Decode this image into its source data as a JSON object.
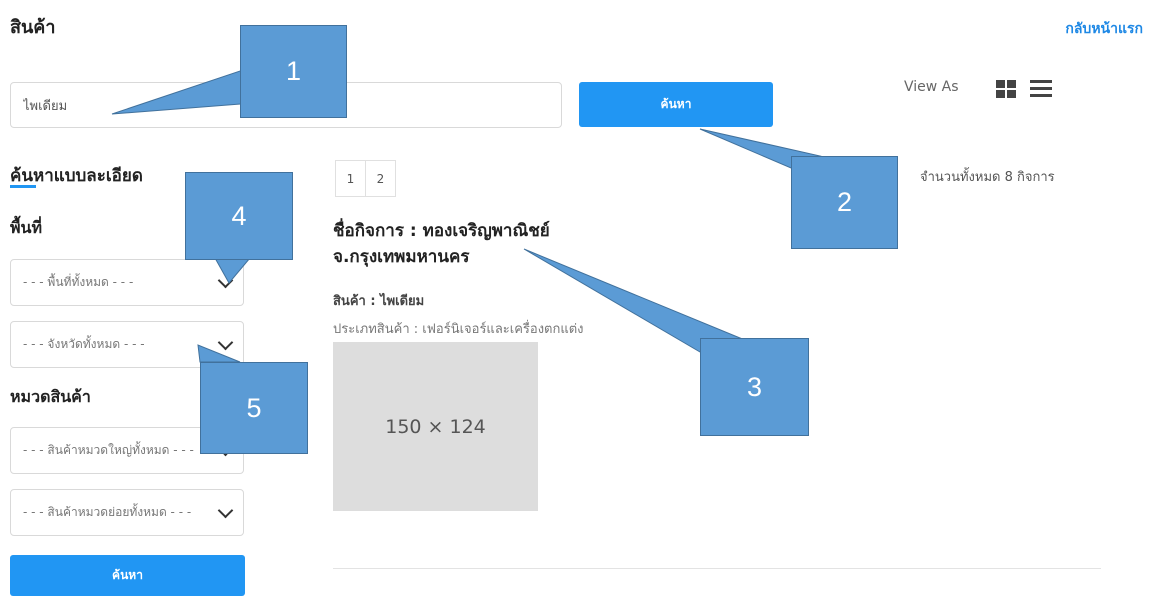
{
  "header": {
    "title": "สินค้า",
    "home_link": "กลับหน้าแรก"
  },
  "search": {
    "value": "ไพเดียม",
    "button_label": "ค้นหา"
  },
  "view": {
    "label": "View As",
    "grid_icon": "grid-icon",
    "list_icon": "list-icon"
  },
  "advanced": {
    "title": "ค้นหาแบบละเอียด",
    "area_label": "พื้นที่",
    "area_select": "- - - พื้นที่ทั้งหมด - - -",
    "province_select": "- - - จังหวัดทั้งหมด - - -",
    "category_label": "หมวดสินค้า",
    "main_category_select": "- - - สินค้าหมวดใหญ่ทั้งหมด - - -",
    "sub_category_select": "- - - สินค้าหมวดย่อยทั้งหมด - - -",
    "button_label": "ค้นหา"
  },
  "pagination": {
    "pages": [
      "1",
      "2"
    ]
  },
  "results": {
    "total": "จำนวนทั้งหมด 8 กิจการ",
    "items": [
      {
        "business_name": "ชื่อกิจการ : ทองเจริญพาณิชย์",
        "province": "จ.กรุงเทพมหานคร",
        "product": "สินค้า : ไพเดียม",
        "product_type": "ประเภทสินค้า : เฟอร์นิเจอร์และเครื่องตกแต่ง",
        "image_placeholder": "150 × 124"
      }
    ]
  },
  "callouts": [
    "1",
    "2",
    "3",
    "4",
    "5"
  ],
  "colors": {
    "accent": "#2196f3",
    "callout_fill": "#5b9bd5",
    "callout_border": "#41719c",
    "image_bg": "#dddddd"
  }
}
